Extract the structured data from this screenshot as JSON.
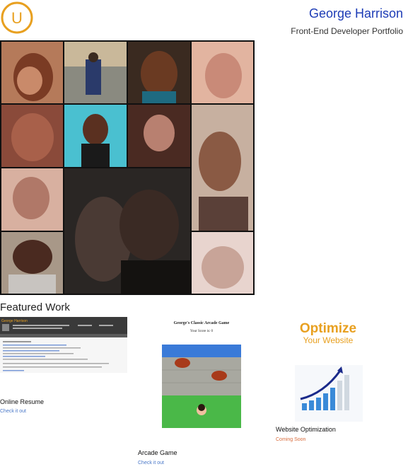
{
  "header": {
    "name": "George Harrison",
    "subtitle": "Front-End Developer Portfolio",
    "logo_letter": "U",
    "accent_color": "#e8a020",
    "name_color": "#1d3cb6"
  },
  "featured": {
    "heading": "Featured Work",
    "items": [
      {
        "title": "Online Resume",
        "link": "Check it out"
      },
      {
        "title": "Arcade Game",
        "link": "Check it out",
        "game_title": "George's Classic Arcade Game",
        "score_text": "Your Score is: 0"
      },
      {
        "title": "Website Optimization",
        "link": "Coming Soon",
        "banner_line1": "Optimize",
        "banner_line2": "Your Website"
      }
    ]
  },
  "resume_preview": {
    "name": "George Harrison"
  }
}
